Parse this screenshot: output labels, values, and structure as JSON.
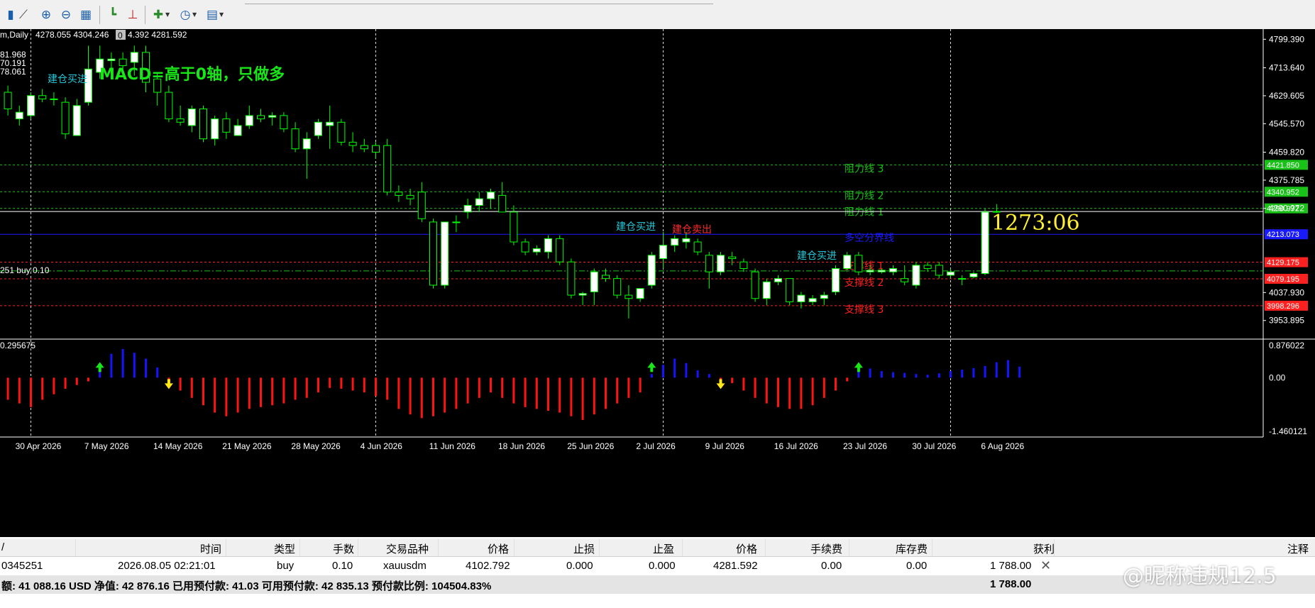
{
  "toolbar": {
    "icons": [
      "bar-chart-icon",
      "zoom-in-icon",
      "zoom-out-icon",
      "tile-windows-icon",
      "auto-scroll-icon",
      "chart-shift-icon",
      "indicators-icon",
      "periods-icon",
      "templates-icon"
    ]
  },
  "chart_info": {
    "symbol_period": "m,Daily",
    "ohlc_text": "4278.055 4304.246",
    "ohlc_box": "0",
    "ohlc_text2": "4.392 4281.592",
    "left_values": [
      "81.968",
      "70.191",
      "78.061"
    ],
    "order_label": "251 buy 0.10",
    "macd_title": "MACD=高于0轴，只做多",
    "countdown": "1273:06",
    "indicator_label": "0.295675"
  },
  "annotations": [
    {
      "text": "建仓买进",
      "color": "#22c6d6",
      "role": "buy"
    },
    {
      "text": "建仓买进",
      "color": "#22c6d6",
      "role": "buy"
    },
    {
      "text": "建仓卖出",
      "color": "#ff2a2a",
      "role": "sell"
    },
    {
      "text": "建仓买进",
      "color": "#22c6d6",
      "role": "buy"
    }
  ],
  "levels": [
    {
      "label": "阻力线 3",
      "price": "4421.850",
      "value": 4421.85,
      "color": "#19c119",
      "style": "dashed"
    },
    {
      "label": "阻力线 2",
      "price": "4340.952",
      "value": 4340.952,
      "color": "#19c119",
      "style": "dashed"
    },
    {
      "label": "阻力线 1",
      "price": "4290.972",
      "value": 4290.972,
      "color": "#19c119",
      "style": "dashed"
    },
    {
      "label": "多空分界线",
      "price": "4213.073",
      "value": 4213.073,
      "color": "#1a1aff",
      "style": "solid"
    },
    {
      "label": "支撑线 1",
      "price": "4129.175",
      "value": 4129.175,
      "color": "#ff2020",
      "style": "dashed"
    },
    {
      "label": "支撑线 2",
      "price": "4079.195",
      "value": 4079.195,
      "color": "#ff2020",
      "style": "dashed"
    },
    {
      "label": "支撑线 3",
      "price": "3998.296",
      "value": 3998.296,
      "color": "#ff2020",
      "style": "dashed"
    }
  ],
  "colors": {
    "bull_candle": "#ffffff",
    "bear_candle": "#000000",
    "wick": "#00ff00",
    "macd_pos": "#1414ff",
    "macd_neg": "#ff1414",
    "axis_text": "#ffffff",
    "grid": "#ffffff",
    "countdown": "#ffee33",
    "order_line": "#19c119",
    "current_price": "#ffffff"
  },
  "chart_data": {
    "type": "candlestick",
    "price_axis": {
      "range": [
        3900,
        4830
      ],
      "ticks": [
        "4799.390",
        "4713.640",
        "4629.605",
        "4545.570",
        "4459.820",
        "4375.785",
        "4290.972",
        "4037.930",
        "3953.895"
      ],
      "tick_values": [
        4799.39,
        4713.64,
        4629.605,
        4545.57,
        4459.82,
        4375.785,
        4290.972,
        4037.93,
        3953.895
      ],
      "current_price": 4281.592,
      "order_price": 4102.792
    },
    "time_axis": {
      "labels": [
        "30 Apr 2026",
        "7 May 2026",
        "14 May 2026",
        "21 May 2026",
        "28 May 2026",
        "4 Jun 2026",
        "11 Jun 2026",
        "18 Jun 2026",
        "25 Jun 2026",
        "2 Jul 2026",
        "9 Jul 2026",
        "16 Jul 2026",
        "23 Jul 2026",
        "30 Jul 2026",
        "6 Aug 2026"
      ],
      "label_bar_index": [
        3,
        9,
        15,
        21,
        27,
        33,
        39,
        45,
        51,
        57,
        63,
        69,
        75,
        81,
        87
      ]
    },
    "vertical_separators_bar": [
      2.5,
      32.5,
      57.5,
      82.5
    ],
    "candles": [
      {
        "o": 4640,
        "h": 4660,
        "l": 4570,
        "c": 4590
      },
      {
        "o": 4560,
        "h": 4600,
        "l": 4540,
        "c": 4580
      },
      {
        "o": 4570,
        "h": 4640,
        "l": 4560,
        "c": 4630
      },
      {
        "o": 4630,
        "h": 4650,
        "l": 4610,
        "c": 4620
      },
      {
        "o": 4620,
        "h": 4640,
        "l": 4600,
        "c": 4620
      },
      {
        "o": 4610,
        "h": 4625,
        "l": 4500,
        "c": 4515
      },
      {
        "o": 4510,
        "h": 4620,
        "l": 4510,
        "c": 4600
      },
      {
        "o": 4610,
        "h": 4780,
        "l": 4600,
        "c": 4710
      },
      {
        "o": 4700,
        "h": 4780,
        "l": 4680,
        "c": 4740
      },
      {
        "o": 4735,
        "h": 4760,
        "l": 4700,
        "c": 4740
      },
      {
        "o": 4740,
        "h": 4760,
        "l": 4700,
        "c": 4720
      },
      {
        "o": 4730,
        "h": 4780,
        "l": 4690,
        "c": 4760
      },
      {
        "o": 4760,
        "h": 4780,
        "l": 4640,
        "c": 4670
      },
      {
        "o": 4680,
        "h": 4700,
        "l": 4600,
        "c": 4640
      },
      {
        "o": 4640,
        "h": 4660,
        "l": 4550,
        "c": 4560
      },
      {
        "o": 4560,
        "h": 4600,
        "l": 4540,
        "c": 4550
      },
      {
        "o": 4540,
        "h": 4600,
        "l": 4520,
        "c": 4590
      },
      {
        "o": 4590,
        "h": 4600,
        "l": 4490,
        "c": 4500
      },
      {
        "o": 4500,
        "h": 4570,
        "l": 4480,
        "c": 4560
      },
      {
        "o": 4560,
        "h": 4580,
        "l": 4500,
        "c": 4520
      },
      {
        "o": 4510,
        "h": 4560,
        "l": 4510,
        "c": 4540
      },
      {
        "o": 4540,
        "h": 4600,
        "l": 4530,
        "c": 4570
      },
      {
        "o": 4570,
        "h": 4590,
        "l": 4550,
        "c": 4560
      },
      {
        "o": 4565,
        "h": 4580,
        "l": 4540,
        "c": 4570
      },
      {
        "o": 4570,
        "h": 4580,
        "l": 4520,
        "c": 4530
      },
      {
        "o": 4530,
        "h": 4550,
        "l": 4460,
        "c": 4470
      },
      {
        "o": 4470,
        "h": 4520,
        "l": 4380,
        "c": 4500
      },
      {
        "o": 4510,
        "h": 4560,
        "l": 4500,
        "c": 4550
      },
      {
        "o": 4540,
        "h": 4600,
        "l": 4470,
        "c": 4550
      },
      {
        "o": 4550,
        "h": 4560,
        "l": 4480,
        "c": 4490
      },
      {
        "o": 4490,
        "h": 4520,
        "l": 4460,
        "c": 4480
      },
      {
        "o": 4480,
        "h": 4500,
        "l": 4460,
        "c": 4470
      },
      {
        "o": 4480,
        "h": 4490,
        "l": 4440,
        "c": 4460
      },
      {
        "o": 4480,
        "h": 4500,
        "l": 4330,
        "c": 4340
      },
      {
        "o": 4340,
        "h": 4360,
        "l": 4310,
        "c": 4330
      },
      {
        "o": 4330,
        "h": 4350,
        "l": 4300,
        "c": 4320
      },
      {
        "o": 4340,
        "h": 4370,
        "l": 4250,
        "c": 4260
      },
      {
        "o": 4250,
        "h": 4260,
        "l": 4050,
        "c": 4060
      },
      {
        "o": 4060,
        "h": 4250,
        "l": 4050,
        "c": 4250
      },
      {
        "o": 4250,
        "h": 4270,
        "l": 4220,
        "c": 4250
      },
      {
        "o": 4280,
        "h": 4320,
        "l": 4260,
        "c": 4300
      },
      {
        "o": 4300,
        "h": 4340,
        "l": 4280,
        "c": 4320
      },
      {
        "o": 4320,
        "h": 4350,
        "l": 4290,
        "c": 4340
      },
      {
        "o": 4330,
        "h": 4370,
        "l": 4280,
        "c": 4280
      },
      {
        "o": 4280,
        "h": 4300,
        "l": 4180,
        "c": 4190
      },
      {
        "o": 4190,
        "h": 4200,
        "l": 4150,
        "c": 4160
      },
      {
        "o": 4160,
        "h": 4180,
        "l": 4150,
        "c": 4170
      },
      {
        "o": 4160,
        "h": 4210,
        "l": 4140,
        "c": 4200
      },
      {
        "o": 4200,
        "h": 4210,
        "l": 4120,
        "c": 4130
      },
      {
        "o": 4130,
        "h": 4140,
        "l": 4020,
        "c": 4030
      },
      {
        "o": 4030,
        "h": 4040,
        "l": 4000,
        "c": 4035
      },
      {
        "o": 4040,
        "h": 4110,
        "l": 4000,
        "c": 4100
      },
      {
        "o": 4090,
        "h": 4110,
        "l": 4070,
        "c": 4080
      },
      {
        "o": 4080,
        "h": 4090,
        "l": 4020,
        "c": 4030
      },
      {
        "o": 4030,
        "h": 4060,
        "l": 3960,
        "c": 4020
      },
      {
        "o": 4020,
        "h": 4050,
        "l": 4010,
        "c": 4050
      },
      {
        "o": 4060,
        "h": 4160,
        "l": 4050,
        "c": 4150
      },
      {
        "o": 4140,
        "h": 4220,
        "l": 4110,
        "c": 4180
      },
      {
        "o": 4180,
        "h": 4210,
        "l": 4160,
        "c": 4200
      },
      {
        "o": 4190,
        "h": 4220,
        "l": 4170,
        "c": 4200
      },
      {
        "o": 4190,
        "h": 4200,
        "l": 4150,
        "c": 4160
      },
      {
        "o": 4150,
        "h": 4160,
        "l": 4050,
        "c": 4100
      },
      {
        "o": 4100,
        "h": 4160,
        "l": 4090,
        "c": 4150
      },
      {
        "o": 4145,
        "h": 4160,
        "l": 4120,
        "c": 4140
      },
      {
        "o": 4130,
        "h": 4140,
        "l": 4100,
        "c": 4110
      },
      {
        "o": 4100,
        "h": 4110,
        "l": 4010,
        "c": 4020
      },
      {
        "o": 4020,
        "h": 4080,
        "l": 4000,
        "c": 4070
      },
      {
        "o": 4070,
        "h": 4090,
        "l": 4060,
        "c": 4080
      },
      {
        "o": 4080,
        "h": 4080,
        "l": 4000,
        "c": 4010
      },
      {
        "o": 4010,
        "h": 4040,
        "l": 3990,
        "c": 4030
      },
      {
        "o": 4010,
        "h": 4030,
        "l": 4000,
        "c": 4020
      },
      {
        "o": 4020,
        "h": 4040,
        "l": 4000,
        "c": 4030
      },
      {
        "o": 4040,
        "h": 4120,
        "l": 4030,
        "c": 4110
      },
      {
        "o": 4110,
        "h": 4160,
        "l": 4100,
        "c": 4150
      },
      {
        "o": 4150,
        "h": 4160,
        "l": 4090,
        "c": 4100
      },
      {
        "o": 4100,
        "h": 4120,
        "l": 4090,
        "c": 4105
      },
      {
        "o": 4100,
        "h": 4110,
        "l": 4095,
        "c": 4105
      },
      {
        "o": 4100,
        "h": 4120,
        "l": 4090,
        "c": 4110
      },
      {
        "o": 4080,
        "h": 4120,
        "l": 4060,
        "c": 4070
      },
      {
        "o": 4060,
        "h": 4130,
        "l": 4050,
        "c": 4120
      },
      {
        "o": 4120,
        "h": 4130,
        "l": 4100,
        "c": 4110
      },
      {
        "o": 4120,
        "h": 4130,
        "l": 4080,
        "c": 4090
      },
      {
        "o": 4090,
        "h": 4110,
        "l": 4080,
        "c": 4100
      },
      {
        "o": 4080,
        "h": 4090,
        "l": 4060,
        "c": 4080
      },
      {
        "o": 4085,
        "h": 4100,
        "l": 4080,
        "c": 4095
      },
      {
        "o": 4095,
        "h": 4290,
        "l": 4090,
        "c": 4280
      },
      {
        "o": 4280,
        "h": 4304,
        "l": 4278,
        "c": 4281.592
      }
    ],
    "macd_histogram": {
      "range": [
        -1.460121,
        0.876022
      ],
      "ticks": [
        "0.876022",
        "0.00",
        "-1.460121"
      ],
      "values": [
        -0.6,
        -0.7,
        -0.8,
        -0.6,
        -0.45,
        -0.3,
        -0.2,
        -0.1,
        0.3,
        0.65,
        0.78,
        0.68,
        0.52,
        0.28,
        -0.1,
        -0.35,
        -0.55,
        -0.75,
        -0.95,
        -1.05,
        -0.95,
        -0.85,
        -0.8,
        -0.75,
        -0.7,
        -0.6,
        -0.55,
        -0.4,
        -0.28,
        -0.3,
        -0.35,
        -0.4,
        -0.5,
        -0.6,
        -0.85,
        -1.0,
        -1.1,
        -1.05,
        -0.95,
        -0.85,
        -0.7,
        -0.55,
        -0.4,
        -0.55,
        -0.7,
        -0.8,
        -0.85,
        -0.9,
        -0.95,
        -1.05,
        -1.15,
        -1.0,
        -0.85,
        -0.7,
        -0.55,
        -0.4,
        0.1,
        0.35,
        0.52,
        0.4,
        0.2,
        0.1,
        -0.05,
        -0.15,
        -0.35,
        -0.55,
        -0.7,
        -0.8,
        -0.85,
        -0.85,
        -0.75,
        -0.55,
        -0.35,
        -0.1,
        0.28,
        0.25,
        0.18,
        0.15,
        0.13,
        0.1,
        0.08,
        0.12,
        0.18,
        0.22,
        0.26,
        0.32,
        0.42,
        0.48,
        0.3
      ],
      "markers": [
        {
          "bar": 8,
          "type": "up",
          "color": "#19e619"
        },
        {
          "bar": 14,
          "type": "down",
          "color": "#ffe619"
        },
        {
          "bar": 56,
          "type": "up",
          "color": "#19e619"
        },
        {
          "bar": 62,
          "type": "down",
          "color": "#ffe619"
        },
        {
          "bar": 74,
          "type": "up",
          "color": "#19e619"
        }
      ]
    }
  },
  "terminal": {
    "headers": {
      "order": "/",
      "time": "时间",
      "type": "类型",
      "lots": "手数",
      "symbol": "交易品种",
      "open_price": "价格",
      "sl": "止损",
      "tp": "止盈",
      "price": "价格",
      "commission": "手续费",
      "swap": "库存费",
      "profit": "获利",
      "comment": "注释"
    },
    "rows": [
      {
        "order": "0345251",
        "time": "2026.08.05 02:21:01",
        "type": "buy",
        "lots": "0.10",
        "symbol": "xauusdm",
        "open_price": "4102.792",
        "sl": "0.000",
        "tp": "0.000",
        "price": "4281.592",
        "commission": "0.00",
        "swap": "0.00",
        "profit": "1 788.00"
      }
    ],
    "summary": "额: 41 088.16 USD  净值: 42 876.16  已用预付款: 41.03  可用预付款: 42 835.13  预付款比例: 104504.83%",
    "summary_profit": "1 788.00"
  },
  "watermark": "@昵称违规12.5"
}
